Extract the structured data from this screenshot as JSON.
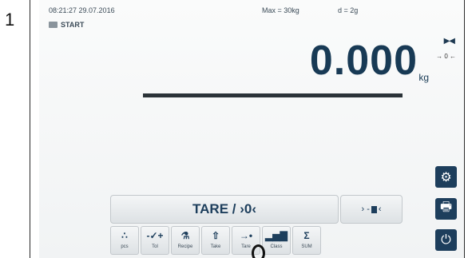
{
  "step_number": "1",
  "status": {
    "datetime": "08:21:27 29.07.2016",
    "max": "Max = 30kg",
    "d": "d = 2g"
  },
  "mode_label": "START",
  "indicators": {
    "stability_icon": "bowtie-icon",
    "zero_indicator": "→ 0 ←"
  },
  "display": {
    "weight": "0.000",
    "unit": "kg"
  },
  "buttons": {
    "tare_label": "TARE / ›0‹",
    "zero_label_left": "› -",
    "zero_label_right": "‹"
  },
  "side_buttons": {
    "settings_icon": "⚙",
    "print_icon": "🖶",
    "power_icon": "⏻"
  },
  "function_keys": [
    {
      "icon": "∴",
      "label": "pcs"
    },
    {
      "icon": "-✓+",
      "label": "Tol"
    },
    {
      "icon": "⚗",
      "label": "Recipe"
    },
    {
      "icon": "⇧",
      "label": "Take"
    },
    {
      "icon": "→•",
      "label": "Tare"
    },
    {
      "icon": "▂▅▇",
      "label": "Class"
    },
    {
      "icon": "Σ",
      "label": "SUM"
    }
  ]
}
